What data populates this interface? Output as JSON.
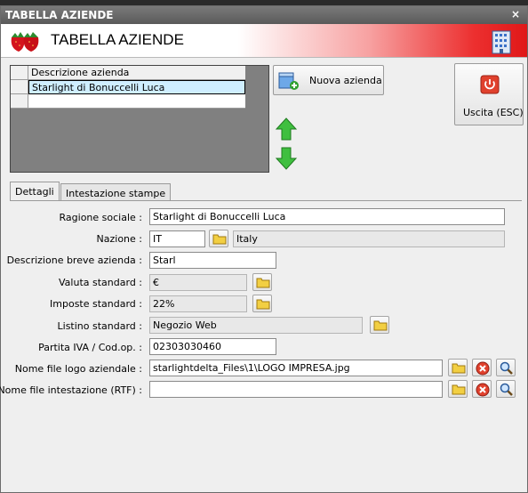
{
  "window": {
    "title": "TABELLA AZIENDE",
    "close_glyph": "×",
    "banner_title": "TABELLA AZIENDE",
    "icons": [
      "strawberry-logo-icon",
      "building-icon",
      "close-icon"
    ],
    "accent_color": "#e01818"
  },
  "grid": {
    "header": "Descrizione azienda",
    "rows": [
      "Starlight di Bonuccelli Luca",
      ""
    ]
  },
  "toolbar": {
    "new_company_label": "Nuova azienda",
    "exit_label": "Uscita (ESC)"
  },
  "tabs": [
    {
      "label": "Dettagli",
      "active": true
    },
    {
      "label": "Intestazione stampe",
      "active": false
    }
  ],
  "form": {
    "ragione_sociale": {
      "label": "Ragione sociale :",
      "value": "Starlight di Bonuccelli Luca"
    },
    "nazione": {
      "label": "Nazione :",
      "code": "IT",
      "name": "Italy"
    },
    "descrizione_breve": {
      "label": "Descrizione breve azienda :",
      "value": "Starl"
    },
    "valuta": {
      "label": "Valuta standard :",
      "value": "€"
    },
    "imposte": {
      "label": "Imposte standard :",
      "value": "22%"
    },
    "listino": {
      "label": "Listino standard :",
      "value": "Negozio Web"
    },
    "partita_iva": {
      "label": "Partita IVA / Cod.op. :",
      "value": "02303030460"
    },
    "logo_file": {
      "label": "Nome file logo aziendale :",
      "value": "starlightdelta_Files\\1\\LOGO IMPRESA.jpg"
    },
    "rtf_file": {
      "label": "Nome file intestazione (RTF) :",
      "value": ""
    }
  }
}
